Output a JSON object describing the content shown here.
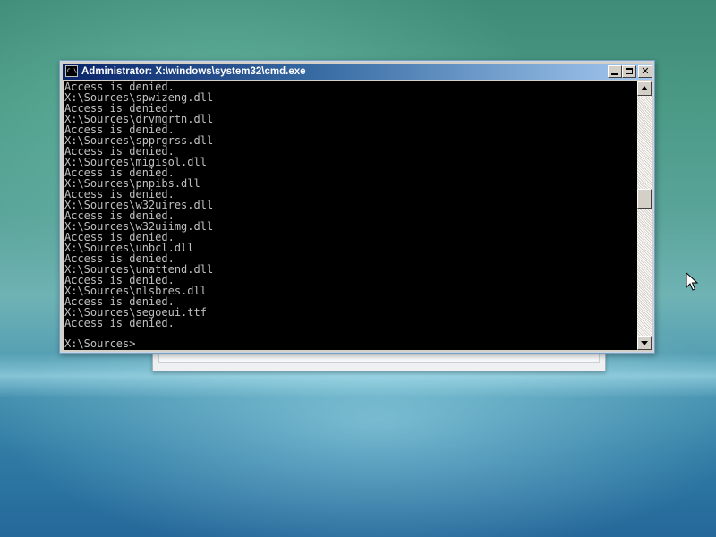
{
  "window": {
    "title": "Administrator: X:\\windows\\system32\\cmd.exe",
    "icon": "cmd-icon",
    "icon_glyph": "C:\\",
    "minimize_glyph": "_",
    "maximize_glyph": "□",
    "close_glyph": "✕"
  },
  "console": {
    "lines": [
      "Access is denied.",
      "X:\\Sources\\spwizeng.dll",
      "Access is denied.",
      "X:\\Sources\\drvmgrtn.dll",
      "Access is denied.",
      "X:\\Sources\\spprgrss.dll",
      "Access is denied.",
      "X:\\Sources\\migisol.dll",
      "Access is denied.",
      "X:\\Sources\\pnpibs.dll",
      "Access is denied.",
      "X:\\Sources\\w32uires.dll",
      "Access is denied.",
      "X:\\Sources\\w32uiimg.dll",
      "Access is denied.",
      "X:\\Sources\\unbcl.dll",
      "Access is denied.",
      "X:\\Sources\\unattend.dll",
      "Access is denied.",
      "X:\\Sources\\nlsbres.dll",
      "Access is denied.",
      "X:\\Sources\\segoeui.ttf",
      "Access is denied."
    ],
    "prompt": "X:\\Sources>",
    "text_color": "#c0c0c0",
    "background_color": "#000000"
  },
  "colors": {
    "titlebar_start": "#0a246a",
    "titlebar_end": "#a6caf0"
  }
}
